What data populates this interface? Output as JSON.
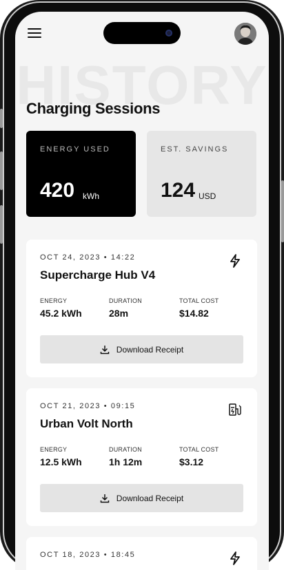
{
  "header": {
    "menu_icon": "hamburger-menu-icon",
    "avatar_icon": "user-avatar"
  },
  "watermark": "HISTORY",
  "page_title": "Charging Sessions",
  "stats": {
    "energy": {
      "label": "ENERGY USED",
      "value": "420",
      "unit": "kWh"
    },
    "savings": {
      "label": "EST. SAVINGS",
      "value": "124",
      "unit": "USD"
    }
  },
  "metric_labels": {
    "energy": "ENERGY",
    "duration": "DURATION",
    "cost": "TOTAL COST"
  },
  "sessions": [
    {
      "date": "OCT 24, 2023 • 14:22",
      "name": "Supercharge Hub V4",
      "icon": "lightning-bolt-icon",
      "energy": "45.2 kWh",
      "duration": "28m",
      "cost": "$14.82",
      "button": "Download Receipt"
    },
    {
      "date": "OCT 21, 2023 • 09:15",
      "name": "Urban Volt North",
      "icon": "ev-station-icon",
      "energy": "12.5 kWh",
      "duration": "1h 12m",
      "cost": "$3.12",
      "button": "Download Receipt"
    },
    {
      "date": "OCT 18, 2023 • 18:45",
      "icon": "lightning-bolt-icon"
    }
  ],
  "colors": {
    "background": "#f5f5f5",
    "card_dark": "#000000",
    "card_light": "#e6e6e6",
    "button": "#e4e4e4",
    "watermark": "#e8e8e8"
  }
}
